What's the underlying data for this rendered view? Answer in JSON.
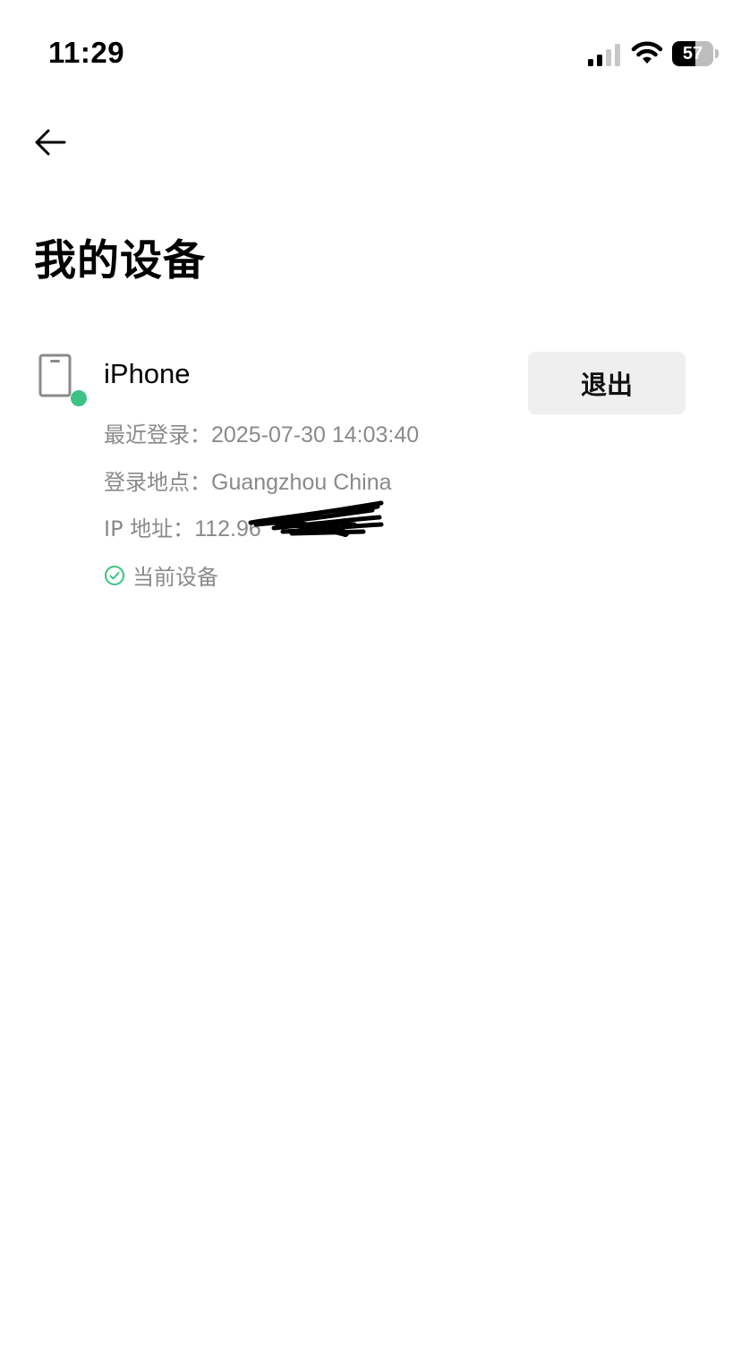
{
  "status_bar": {
    "time": "11:29",
    "battery": "57"
  },
  "header": {
    "title": "我的设备"
  },
  "device": {
    "name": "iPhone",
    "logout_label": "退出",
    "last_login_label": "最近登录：",
    "last_login_value": "2025-07-30 14:03:40",
    "location_label": "登录地点：",
    "location_value": "Guangzhou China",
    "ip_label": "IP 地址：",
    "ip_value": "112.96",
    "current_device_label": "当前设备",
    "online_status_color": "#3cc283"
  },
  "icons": {
    "back": "arrow-left-icon",
    "device": "phone-icon",
    "check": "check-circle-icon",
    "signal": "cellular-signal-icon",
    "wifi": "wifi-icon"
  },
  "colors": {
    "accent_green": "#3cc283",
    "secondary_text": "#8a8a8a",
    "button_bg": "#efefef"
  }
}
